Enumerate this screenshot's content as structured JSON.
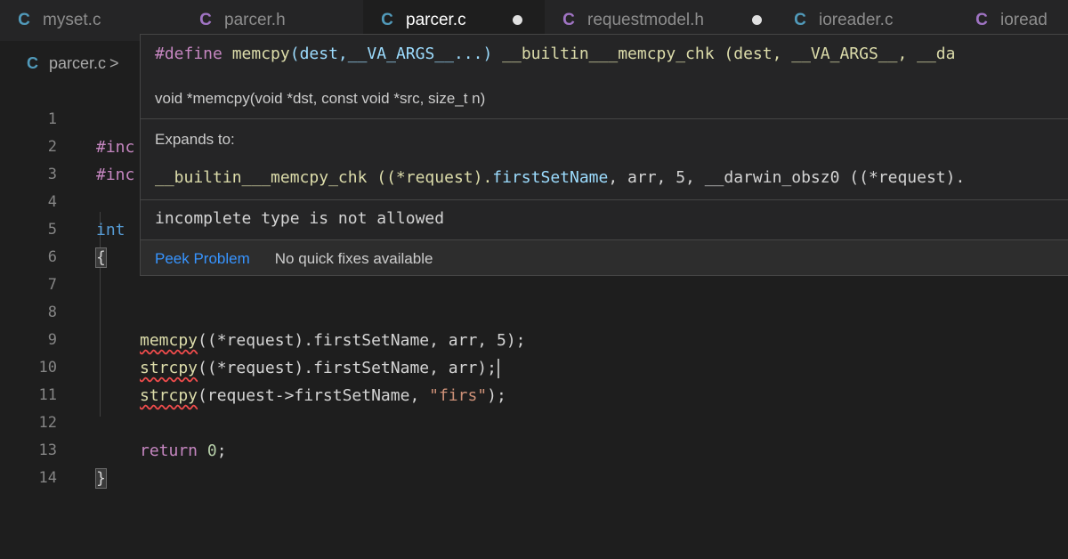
{
  "colors": {
    "background": "#1e1e1e",
    "tab_bar": "#252526",
    "c_icon_blue": "#519aba",
    "c_icon_purple": "#a074c4",
    "link": "#3794ff",
    "error_squiggle": "#f14c4c"
  },
  "tabs": [
    {
      "icon": "C",
      "icon_color": "#519aba",
      "label": "myset.c",
      "active": false,
      "dirty": false
    },
    {
      "icon": "C",
      "icon_color": "#a074c4",
      "label": "parcer.h",
      "active": false,
      "dirty": false
    },
    {
      "icon": "C",
      "icon_color": "#519aba",
      "label": "parcer.c",
      "active": true,
      "dirty": true
    },
    {
      "icon": "C",
      "icon_color": "#a074c4",
      "label": "requestmodel.h",
      "active": false,
      "dirty": true
    },
    {
      "icon": "C",
      "icon_color": "#519aba",
      "label": "ioreader.c",
      "active": false,
      "dirty": false
    },
    {
      "icon": "C",
      "icon_color": "#a074c4",
      "label": "ioread",
      "active": false,
      "dirty": false
    }
  ],
  "breadcrumb": {
    "icon": "C",
    "file": "parcer.c",
    "separator": ">"
  },
  "editor": {
    "line_numbers": [
      "1",
      "2",
      "3",
      "4",
      "5",
      "6",
      "7",
      "8",
      "9",
      "10",
      "11",
      "12",
      "13",
      "14"
    ],
    "lines": {
      "l1": "#inc",
      "l2": "#inc",
      "l4": "int",
      "l5": "{",
      "l8_func": "memcpy",
      "l8_rest": "((*request).firstSetName, arr, 5);",
      "l9_func": "strcpy",
      "l9_rest": "((*request).firstSetName, arr);",
      "l10_func": "strcpy",
      "l10_open": "(request->firstSetName, ",
      "l10_str": "\"firs\"",
      "l10_close": ");",
      "l12_kw": "return",
      "l12_num": "0",
      "l12_semi": ";",
      "l13": "}"
    }
  },
  "hover": {
    "define_kw": "#define",
    "define_name": "memcpy",
    "define_params": "(dest,__VA_ARGS__...)",
    "define_body": " __builtin___memcpy_chk (dest, __VA_ARGS__, __da",
    "signature": "void *memcpy(void *dst, const void *src, size_t n)",
    "expands_label": "Expands to:",
    "expansion_pre": "__builtin___memcpy_chk ((*request).",
    "expansion_field": "firstSetName",
    "expansion_post": ", arr, 5, __darwin_obsz0 ((*request).",
    "error": "incomplete type is not allowed",
    "peek_problem": "Peek Problem",
    "no_quick_fixes": "No quick fixes available"
  }
}
